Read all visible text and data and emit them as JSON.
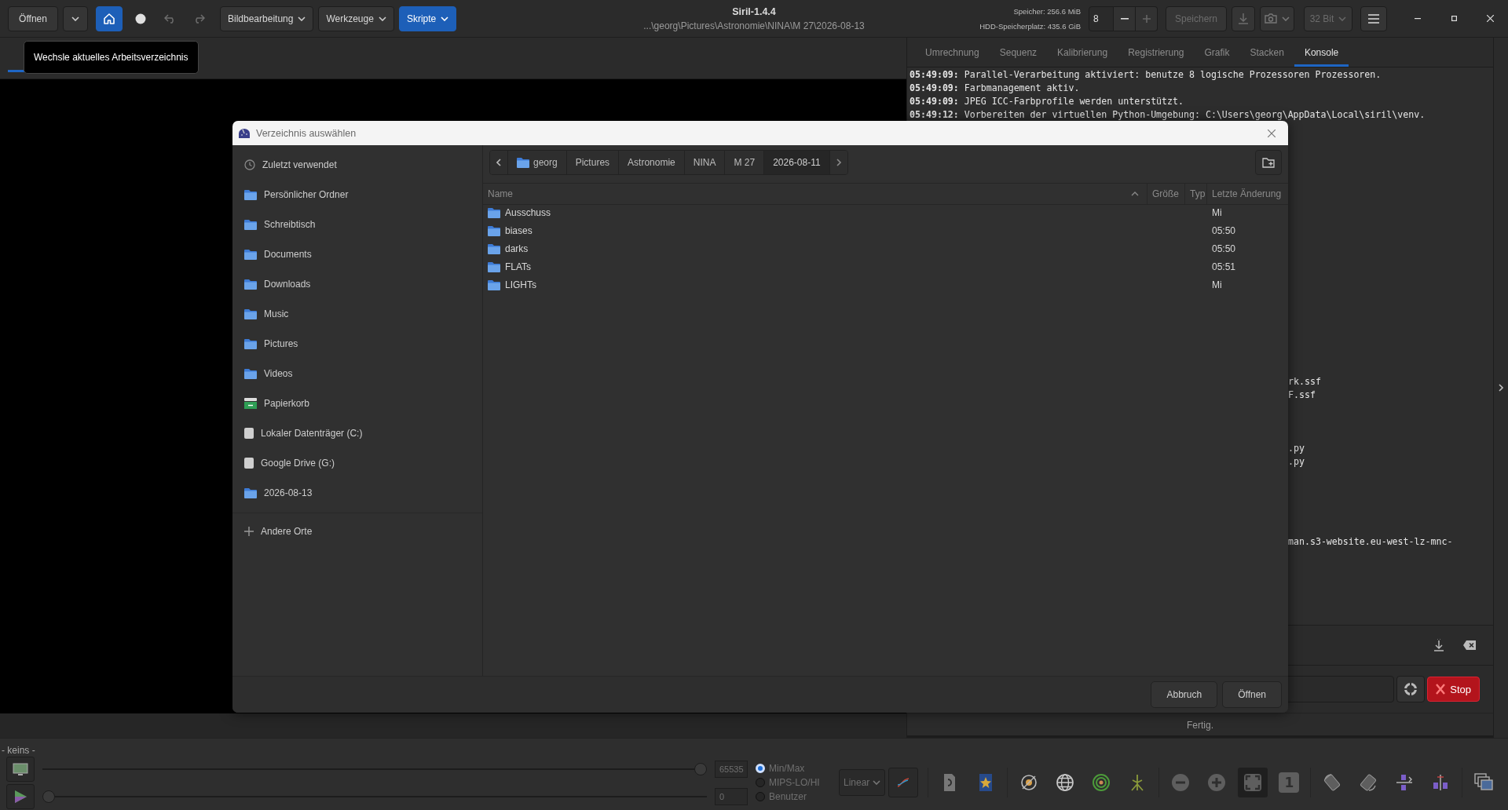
{
  "toolbar": {
    "open": "Öffnen",
    "home": {
      "selected": true
    },
    "menus": [
      {
        "label": "Bildbearbeitung",
        "selected": false
      },
      {
        "label": "Werkzeuge",
        "selected": false
      },
      {
        "label": "Skripte",
        "selected": true
      }
    ],
    "title": "Siril-1.4.4",
    "path": "...\\georg\\Pictures\\Astronomie\\NINA\\M 27\\2026-08-13",
    "memory": "Speicher: 256.6 MiB",
    "disk": "HDD-Speicherplatz: 435.6 GiB",
    "threads": "8",
    "save": {
      "label": "Speichern",
      "disabled": true
    },
    "bit_depth": {
      "label": "32 Bit",
      "disabled": true
    }
  },
  "tooltip": "Wechsle aktuelles Arbeitsverzeichnis",
  "panel_tabs": [
    {
      "label": "Umrechnung",
      "selected": false
    },
    {
      "label": "Sequenz",
      "selected": false
    },
    {
      "label": "Kalibrierung",
      "selected": false
    },
    {
      "label": "Registrierung",
      "selected": false
    },
    {
      "label": "Grafik",
      "selected": false
    },
    {
      "label": "Stacken",
      "selected": false
    },
    {
      "label": "Konsole",
      "selected": true
    }
  ],
  "console": {
    "lines": [
      {
        "kind": "full",
        "time": "05:49:09:",
        "text": "Parallel-Verarbeitung aktiviert: benutze 8 logische Prozessoren Prozessoren."
      },
      {
        "kind": "full",
        "time": "05:49:09:",
        "text": "Farbmanagement aktiv."
      },
      {
        "kind": "full",
        "time": "05:49:09:",
        "text": "JPEG ICC-Farbprofile werden unterstützt."
      },
      {
        "kind": "full",
        "time": "05:49:12:",
        "text": "Vorbereiten der virtuellen Python-Umgebung: C:\\Users\\georg\\AppData\\Local\\siril\\venv."
      },
      {
        "kind": "fragment",
        "text": "rk.ssf"
      },
      {
        "kind": "fragment",
        "text": "F.ssf"
      },
      {
        "kind": "fragment",
        "text": ".py"
      },
      {
        "kind": "fragment",
        "text": ".py"
      },
      {
        "kind": "fragment",
        "text": "man.s3-website.eu-west-lz-mnc-"
      }
    ],
    "stop": "Stop",
    "status": "Fertig."
  },
  "dialog": {
    "title": "Verzeichnis auswählen",
    "places": [
      {
        "label": "Zuletzt verwendet",
        "kind": "recent"
      },
      {
        "label": "Persönlicher Ordner",
        "kind": "folder"
      },
      {
        "label": "Schreibtisch",
        "kind": "folder"
      },
      {
        "label": "Documents",
        "kind": "folder"
      },
      {
        "label": "Downloads",
        "kind": "folder"
      },
      {
        "label": "Music",
        "kind": "folder"
      },
      {
        "label": "Pictures",
        "kind": "folder"
      },
      {
        "label": "Videos",
        "kind": "folder"
      },
      {
        "label": "Papierkorb",
        "kind": "trash"
      },
      {
        "label": "Lokaler Datenträger (C:)",
        "kind": "drive"
      },
      {
        "label": "Google Drive (G:)",
        "kind": "drive"
      },
      {
        "label": "2026-08-13",
        "kind": "folder"
      }
    ],
    "other_places": "Andere Orte",
    "path": [
      {
        "label": "georg",
        "selected": false
      },
      {
        "label": "Pictures",
        "selected": false
      },
      {
        "label": "Astronomie",
        "selected": false
      },
      {
        "label": "NINA",
        "selected": false
      },
      {
        "label": "M 27",
        "selected": false
      },
      {
        "label": "2026-08-11",
        "selected": true
      }
    ],
    "columns": [
      "Name",
      "Größe",
      "Typ",
      "Letzte Änderung"
    ],
    "rows": [
      {
        "name": "Ausschuss",
        "modified": "Mi"
      },
      {
        "name": "biases",
        "modified": "05:50"
      },
      {
        "name": "darks",
        "modified": "05:50"
      },
      {
        "name": "FLATs",
        "modified": "05:51"
      },
      {
        "name": "LIGHTs",
        "modified": "Mi"
      }
    ],
    "buttons": [
      "Abbruch",
      "Öffnen"
    ]
  },
  "display": {
    "status": "- keins -",
    "high": {
      "level": 1,
      "value": "65535"
    },
    "low": {
      "level": 0,
      "value": "0"
    },
    "modes": [
      {
        "label": "Min/Max",
        "selected": true
      },
      {
        "label": "MIPS-LO/HI",
        "selected": false
      },
      {
        "label": "Benutzer",
        "selected": false
      }
    ],
    "scale": "Linear",
    "zoom_one": "1"
  }
}
